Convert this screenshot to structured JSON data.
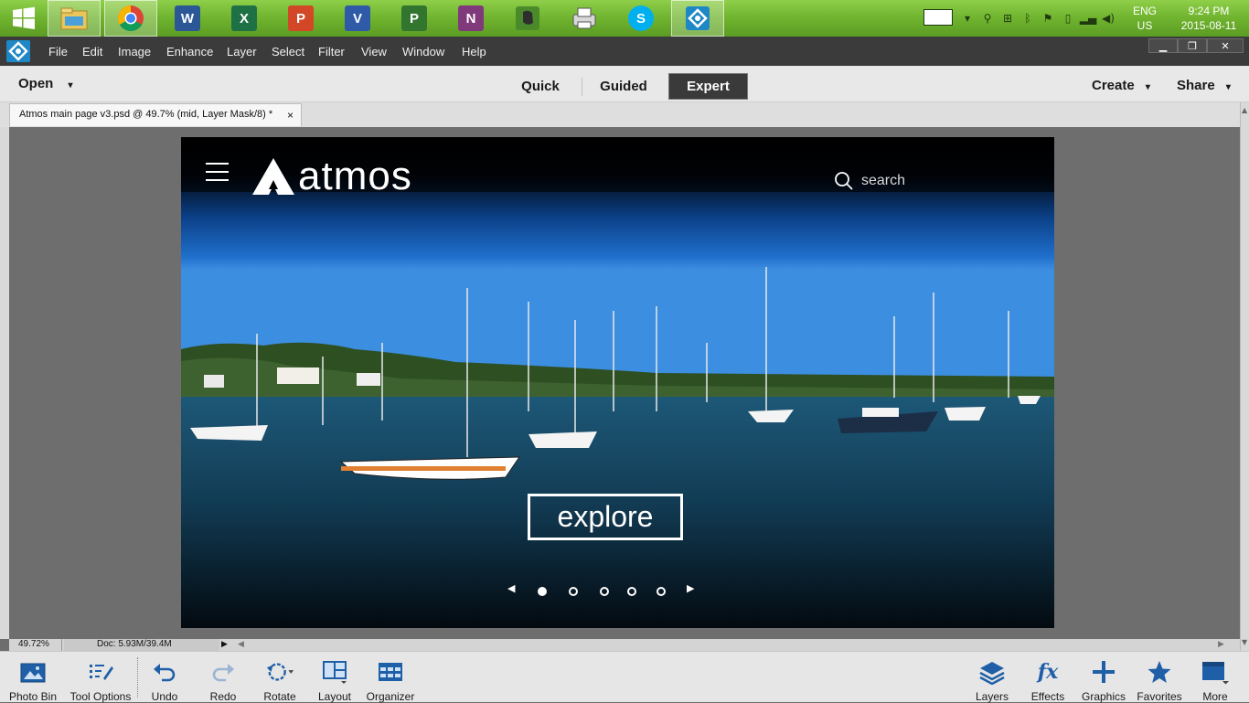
{
  "taskbar": {
    "apps": [
      {
        "name": "Start",
        "icon": "windows-start-icon"
      },
      {
        "name": "File Explorer",
        "icon": "file-explorer-icon"
      },
      {
        "name": "Chrome",
        "icon": "chrome-icon"
      },
      {
        "name": "Word",
        "letter": "W",
        "color": "#2b5797"
      },
      {
        "name": "Excel",
        "letter": "X",
        "color": "#1e7145"
      },
      {
        "name": "PowerPoint",
        "letter": "P",
        "color": "#d24726"
      },
      {
        "name": "Visio",
        "letter": "V",
        "color": "#2e5aa8"
      },
      {
        "name": "Project",
        "letter": "P",
        "color": "#31752f"
      },
      {
        "name": "OneNote",
        "letter": "N",
        "color": "#80397b"
      },
      {
        "name": "Evernote",
        "icon": "evernote-icon"
      },
      {
        "name": "Printer",
        "icon": "printer-icon"
      },
      {
        "name": "Skype",
        "letter": "S",
        "color": "#00aff0"
      },
      {
        "name": "Photoshop Elements",
        "icon": "photoshop-elements-icon"
      }
    ],
    "tray": {
      "lang_top": "ENG",
      "lang_bottom": "US",
      "time": "9:24 PM",
      "date": "2015-08-11"
    }
  },
  "menubar": {
    "items": [
      "File",
      "Edit",
      "Image",
      "Enhance",
      "Layer",
      "Select",
      "Filter",
      "View",
      "Window",
      "Help"
    ]
  },
  "modebar": {
    "open_label": "Open",
    "modes": [
      "Quick",
      "Guided",
      "Expert"
    ],
    "active_mode": "Expert",
    "create_label": "Create",
    "share_label": "Share"
  },
  "document": {
    "tab_title": "Atmos main page v3.psd @ 49.7% (mid, Layer Mask/8) *",
    "close_glyph": "×"
  },
  "canvas_content": {
    "logo_text": "atmos",
    "search_placeholder": "search",
    "cta_label": "explore",
    "carousel": {
      "dots": 5,
      "active_index": 0
    }
  },
  "status": {
    "zoom": "49.72%",
    "doc_size": "Doc: 5.93M/39.4M"
  },
  "bottom_left": [
    {
      "label": "Photo Bin",
      "icon": "photo-bin-icon"
    },
    {
      "label": "Tool Options",
      "icon": "tool-options-icon"
    },
    {
      "label": "Undo",
      "icon": "undo-icon"
    },
    {
      "label": "Redo",
      "icon": "redo-icon"
    },
    {
      "label": "Rotate",
      "icon": "rotate-icon"
    },
    {
      "label": "Layout",
      "icon": "layout-icon"
    },
    {
      "label": "Organizer",
      "icon": "organizer-icon"
    }
  ],
  "bottom_right": [
    {
      "label": "Layers",
      "icon": "layers-icon"
    },
    {
      "label": "Effects",
      "icon": "effects-icon"
    },
    {
      "label": "Graphics",
      "icon": "graphics-icon"
    },
    {
      "label": "Favorites",
      "icon": "favorites-icon"
    },
    {
      "label": "More",
      "icon": "more-icon"
    }
  ],
  "colors": {
    "accent": "#6fb32e",
    "panel_dark": "#3b3b3b",
    "icon_blue": "#1f5fa8"
  }
}
